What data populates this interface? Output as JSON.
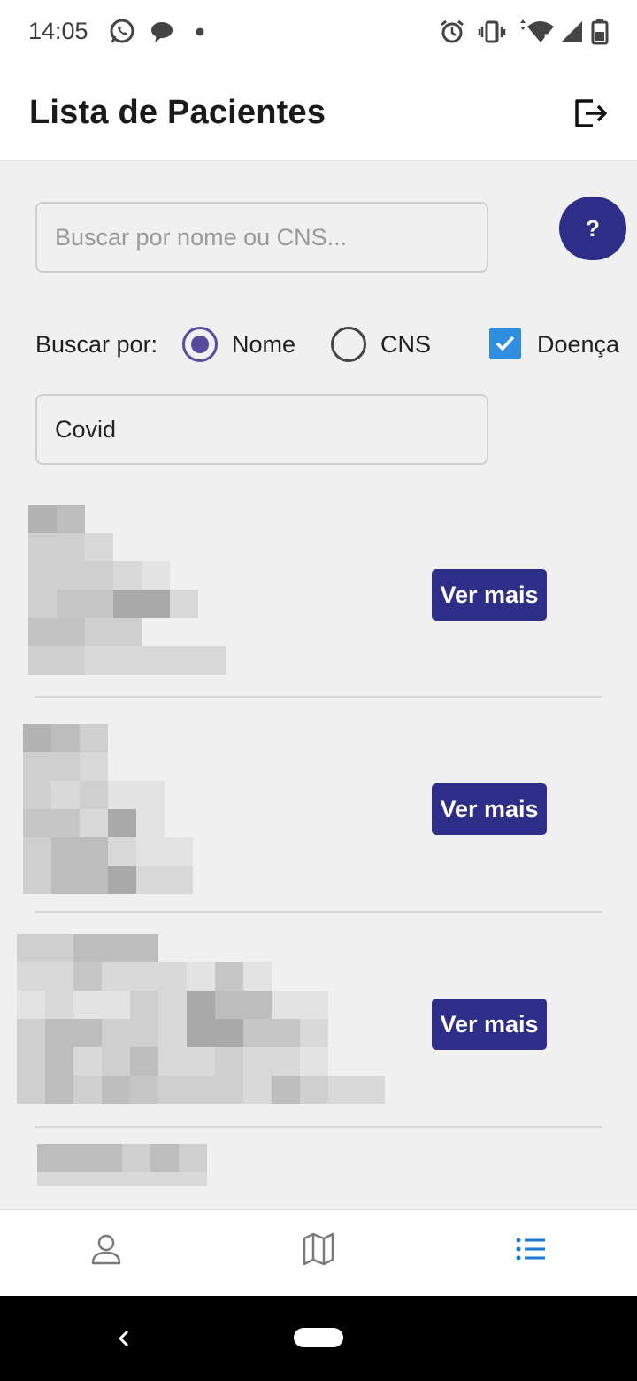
{
  "status_bar": {
    "time": "14:05",
    "left_icons": [
      "whatsapp-icon",
      "chat-bubble-icon",
      "dot-icon"
    ],
    "right_icons": [
      "alarm-icon",
      "vibrate-icon",
      "wifi-icon",
      "signal-icon",
      "battery-icon"
    ]
  },
  "header": {
    "title": "Lista de Pacientes",
    "logout_icon": "logout-icon"
  },
  "search": {
    "placeholder": "Buscar por nome ou CNS...",
    "value": "",
    "help_label": "?"
  },
  "filter": {
    "label": "Buscar por:",
    "options": [
      {
        "label": "Nome",
        "type": "radio",
        "checked": true
      },
      {
        "label": "CNS",
        "type": "radio",
        "checked": false
      },
      {
        "label": "Doença",
        "type": "checkbox",
        "checked": true
      }
    ],
    "disease_value": "Covid"
  },
  "patients": [
    {
      "action_label": "Ver mais"
    },
    {
      "action_label": "Ver mais"
    },
    {
      "action_label": "Ver mais"
    },
    {
      "action_label": ""
    }
  ],
  "bottom_nav": {
    "items": [
      {
        "icon": "user-icon",
        "active": false
      },
      {
        "icon": "map-icon",
        "active": false
      },
      {
        "icon": "list-icon",
        "active": true
      }
    ],
    "active_color": "#1e78d6",
    "inactive_color": "#7a7a7a"
  },
  "colors": {
    "primary": "#2e2d88",
    "radio_accent": "#5a4a9e",
    "checkbox_accent": "#2f8ee0",
    "background": "#f0f0f0"
  }
}
